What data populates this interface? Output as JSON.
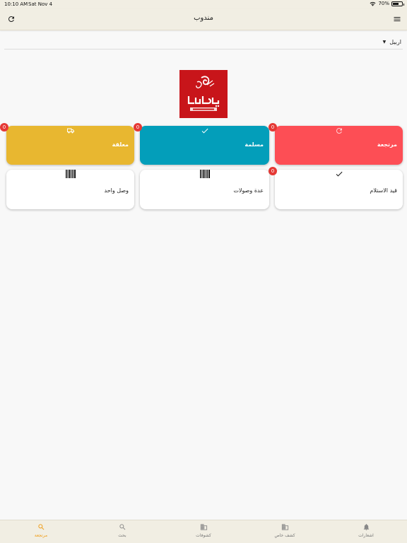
{
  "status_bar": {
    "time": "10:10 AM",
    "date": "Sat Nov 4",
    "battery": "70%",
    "battery_level": 0.7
  },
  "app_bar": {
    "title": "مندوب"
  },
  "city_select": {
    "value": "اربيل"
  },
  "cards": {
    "returned": {
      "label": "مرتجعة",
      "count": "0",
      "color": "#fd4e55",
      "icon": "refresh-icon"
    },
    "delivered": {
      "label": "مسلمة",
      "count": "0",
      "color": "#039eba",
      "icon": "checkmark-icon"
    },
    "suspended": {
      "label": "معلقة",
      "count": "0",
      "color": "#e8b730",
      "icon": "delivery-truck-icon"
    },
    "pending_receipt": {
      "label": "قيد الاستلام",
      "count": "0",
      "icon": "checkmark-icon"
    },
    "multiple_receipts": {
      "label": "عدة وصولات",
      "icon": "barcode-icon"
    },
    "single_receipt": {
      "label": "وصل واحد",
      "icon": "barcode-icon"
    }
  },
  "nav": {
    "notifications": "اشعارات",
    "my_statement": "كشف خاص",
    "statements": "كشوفات",
    "search": "بحث",
    "returned": "مرتجعة",
    "active_color": "#f09b12"
  }
}
